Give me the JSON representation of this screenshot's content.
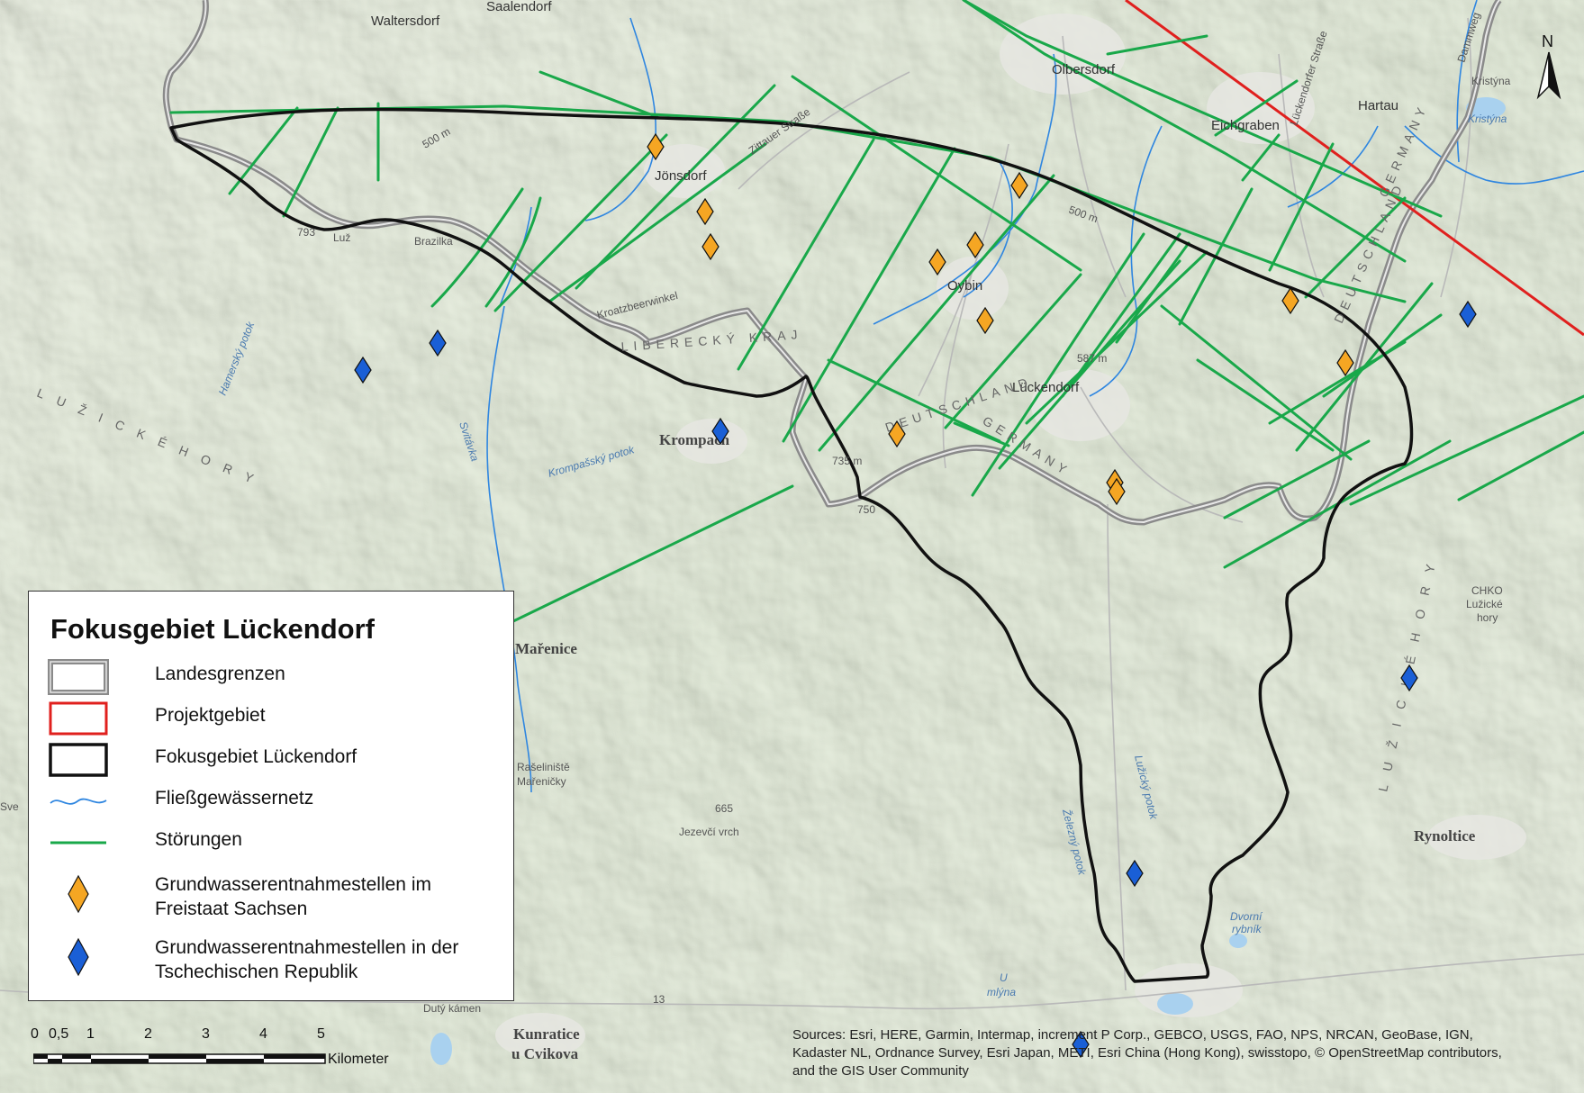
{
  "legend": {
    "title": "Fokusgebiet Lückendorf",
    "items": [
      {
        "label": "Landesgrenzen",
        "kind": "border"
      },
      {
        "label": "Projektgebiet",
        "kind": "project"
      },
      {
        "label": "Fokusgebiet Lückendorf",
        "kind": "focus"
      },
      {
        "label": "Fließgewässernetz",
        "kind": "river"
      },
      {
        "label": "Störungen",
        "kind": "fault"
      },
      {
        "label": "Grundwasserentnahmestellen im Freistaat Sachsen",
        "line1": "Grundwasserentnahmestellen im",
        "line2": "Freistaat Sachsen",
        "kind": "well-saxony"
      },
      {
        "label": "Grundwasserentnahmestellen in der Tschechischen Republik",
        "line1": "Grundwasserentnahmestellen in der",
        "line2": "Tschechischen Republik",
        "kind": "well-czech"
      }
    ]
  },
  "scalebar": {
    "ticks": [
      "0",
      "0,5",
      "1",
      "2",
      "3",
      "4",
      "5"
    ],
    "unit": "Kilometer"
  },
  "north_arrow": {
    "label": "N"
  },
  "sources": "Sources: Esri, HERE, Garmin, Intermap, increment P Corp., GEBCO, USGS, FAO, NPS, NRCAN, GeoBase, IGN, Kadaster NL, Ordnance Survey, Esri Japan, METI, Esri China (Hong Kong), swisstopo, © OpenStreetMap contributors, and the GIS User Community",
  "places": {
    "waltersdorf": "Waltersdorf",
    "saalendorf": "Saalendorf",
    "olbersdorf": "Olbersdorf",
    "hartau": "Hartau",
    "kristyna": "Kristýna",
    "kristyna_lake": "Kristýna",
    "eichgraben": "Eichgraben",
    "jonsdorf": "Jönsdorf",
    "oybin": "Oybin",
    "luckendorf": "Lückendorf",
    "krompach": "Krompach",
    "luz": "Luž",
    "brazilka": "Brazilka",
    "marenice": "Mařenice",
    "jezevci": "Jezevčí vrch",
    "raseliniste": "Rašeliniště",
    "marenicky": "Mařeničky",
    "duty_kamen": "Dutý kámen",
    "kunratice1": "Kunratice",
    "kunratice2": "u Cvikova",
    "rynoltice": "Rynoltice",
    "chko1": "CHKO",
    "chko2": "Lužické",
    "chko3": "hory",
    "dvorni1": "Dvorní",
    "dvorni2": "rybník",
    "u_mlyna1": "U",
    "u_mlyna2": "mlýna",
    "liberecky": "LIBERECKÝ KRAJ",
    "deutschland1": "DEUTSCHLAND",
    "germany1": "GERMANY",
    "deutschland2": "DEUTSCHLAND",
    "germany2": "GERMANY",
    "luzicke_hory_w": "L U Ž I C K É   H O R Y",
    "luzicke_hory_e": "L U Ž I C K É   H O R Y",
    "zittauer": "Zittauer Straße",
    "luckendorfer": "Lückendorfer Straße",
    "kammweg": "Dammweg",
    "kroatzbeer": "Kroatzbeerwinkel",
    "hamersky": "Hamerský potok",
    "svitavka": "Svitávka",
    "krompassky": "Krompašský potok",
    "luzicky": "Lužický potok",
    "zelezny": "Železný potok",
    "h793": "793",
    "h500a": "500 m",
    "h500b": "500 m",
    "h587": "587 m",
    "h735": "735 m",
    "h750": "750",
    "h665": "665",
    "road13": "13",
    "sve": "Sve"
  },
  "colors": {
    "border": "#8a8a8a",
    "project": "#e0201e",
    "focus": "#111111",
    "river": "#2f86e0",
    "fault": "#19a84a",
    "well_saxony": "#f5a623",
    "well_czech": "#1a5fd6",
    "terrain": "#d8e6c9"
  }
}
